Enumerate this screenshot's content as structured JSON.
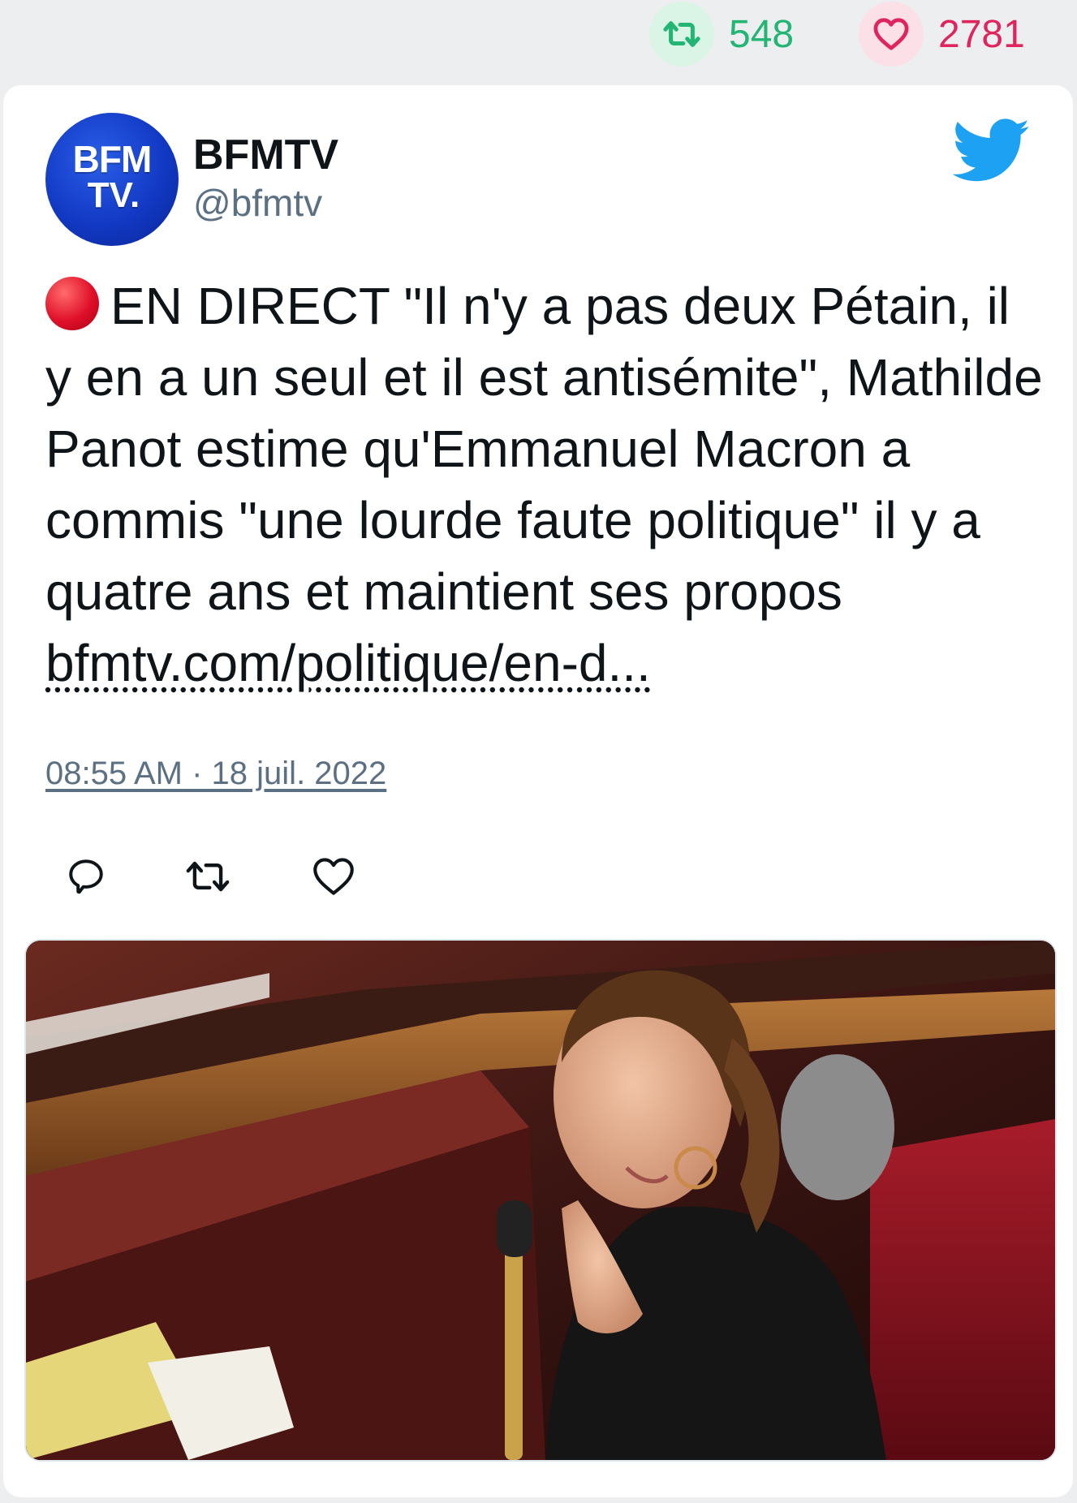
{
  "stats": {
    "retweets": "548",
    "likes": "2781"
  },
  "tweet": {
    "author_name": "BFMTV",
    "author_handle": "@bfmtv",
    "avatar_text_line1": "BFM",
    "avatar_text_line2": "TV.",
    "text": "EN DIRECT \"Il n'y a pas deux Pétain, il y en a un seul et il est antisémite\", Mathilde Panot estime qu'Emmanuel Macron a commis \"une lourde faute politique\" il y a quatre ans et maintient ses propos ",
    "link_text": "bfmtv.com/politique/en-d...",
    "timestamp": "08:55 AM · 18 juil. 2022"
  },
  "icons": {
    "retweet": "retweet-icon",
    "like": "heart-icon",
    "reply": "reply-icon",
    "brand": "twitter-bird-icon",
    "live": "red-circle-icon"
  },
  "colors": {
    "retweet_green": "#22b573",
    "like_pink": "#e0245e",
    "twitter_blue": "#1da1f2",
    "muted": "#5b7083"
  }
}
